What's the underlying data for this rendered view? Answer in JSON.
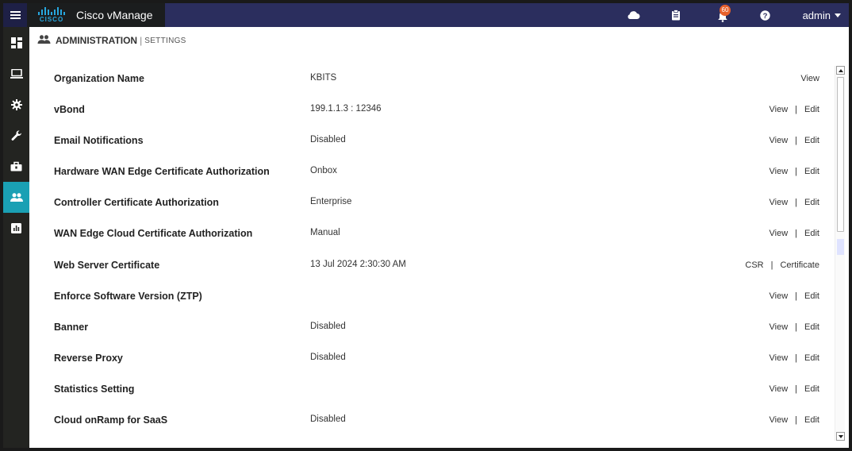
{
  "app": {
    "brand_word": "CISCO",
    "title": "Cisco vManage"
  },
  "topbar": {
    "notification_count": "60",
    "user": "admin",
    "icons": [
      "cloud-icon",
      "clipboard-icon",
      "bell-icon",
      "help-icon"
    ]
  },
  "sidebar": {
    "items": [
      {
        "icon": "dashboard-icon"
      },
      {
        "icon": "monitor-icon"
      },
      {
        "icon": "configuration-gear-icon"
      },
      {
        "icon": "tools-wrench-icon"
      },
      {
        "icon": "maintenance-toolbox-icon"
      },
      {
        "icon": "administration-users-icon",
        "active": true
      },
      {
        "icon": "analytics-chart-icon"
      }
    ]
  },
  "breadcrumb": {
    "main": "ADMINISTRATION",
    "separator": "|",
    "sub": "SETTINGS"
  },
  "settings": [
    {
      "name": "Organization Name",
      "value": "KBITS",
      "actions": [
        "View"
      ]
    },
    {
      "name": "vBond",
      "value": "199.1.1.3 : 12346",
      "actions": [
        "View",
        "Edit"
      ]
    },
    {
      "name": "Email Notifications",
      "value": "Disabled",
      "actions": [
        "View",
        "Edit"
      ]
    },
    {
      "name": "Hardware WAN Edge Certificate Authorization",
      "value": "Onbox",
      "actions": [
        "View",
        "Edit"
      ]
    },
    {
      "name": "Controller Certificate Authorization",
      "value": "Enterprise",
      "actions": [
        "View",
        "Edit"
      ]
    },
    {
      "name": "WAN Edge Cloud Certificate Authorization",
      "value": "Manual",
      "actions": [
        "View",
        "Edit"
      ]
    },
    {
      "name": "Web Server Certificate",
      "value": "13 Jul 2024 2:30:30 AM",
      "actions": [
        "CSR",
        "Certificate"
      ]
    },
    {
      "name": "Enforce Software Version (ZTP)",
      "value": "",
      "actions": [
        "View",
        "Edit"
      ]
    },
    {
      "name": "Banner",
      "value": "Disabled",
      "actions": [
        "View",
        "Edit"
      ]
    },
    {
      "name": "Reverse Proxy",
      "value": "Disabled",
      "actions": [
        "View",
        "Edit"
      ]
    },
    {
      "name": "Statistics Setting",
      "value": "",
      "actions": [
        "View",
        "Edit"
      ]
    },
    {
      "name": "Cloud onRamp for SaaS",
      "value": "Disabled",
      "actions": [
        "View",
        "Edit"
      ]
    }
  ],
  "colors": {
    "topbar": "#2b2e5e",
    "sidebar": "#232421",
    "sidebar_active": "#1aa0b4",
    "badge": "#e8612c",
    "cisco_blue": "#27a7df"
  }
}
